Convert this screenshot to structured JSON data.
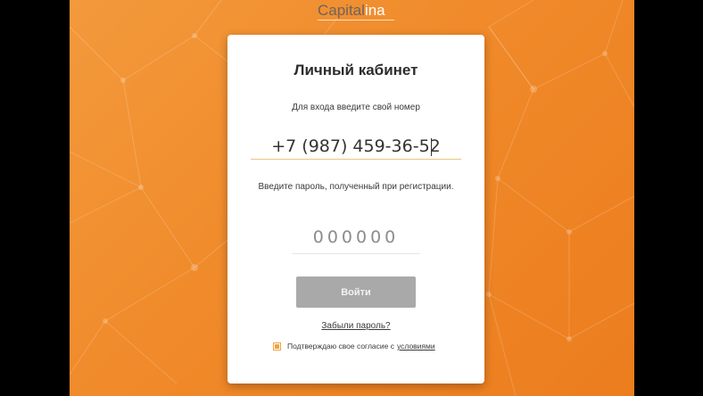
{
  "brand": {
    "part1": "Capital",
    "part2": "ina"
  },
  "login": {
    "title": "Личный кабинет",
    "phone_hint": "Для входа введите свой номер",
    "phone_value": "+7 (987) 459-36-52",
    "password_hint": "Введите пароль, полученный при регистрации.",
    "code_placeholder": "000000",
    "submit_label": "Войти",
    "forgot_label": "Забыли пароль?",
    "consent_text": "Подтверждаю свое согласие с",
    "consent_link": "условиями",
    "consent_checked": true
  },
  "colors": {
    "background_orange": "#f08a2a",
    "accent": "#f0a23c",
    "button_disabled": "#a9a9a9"
  }
}
